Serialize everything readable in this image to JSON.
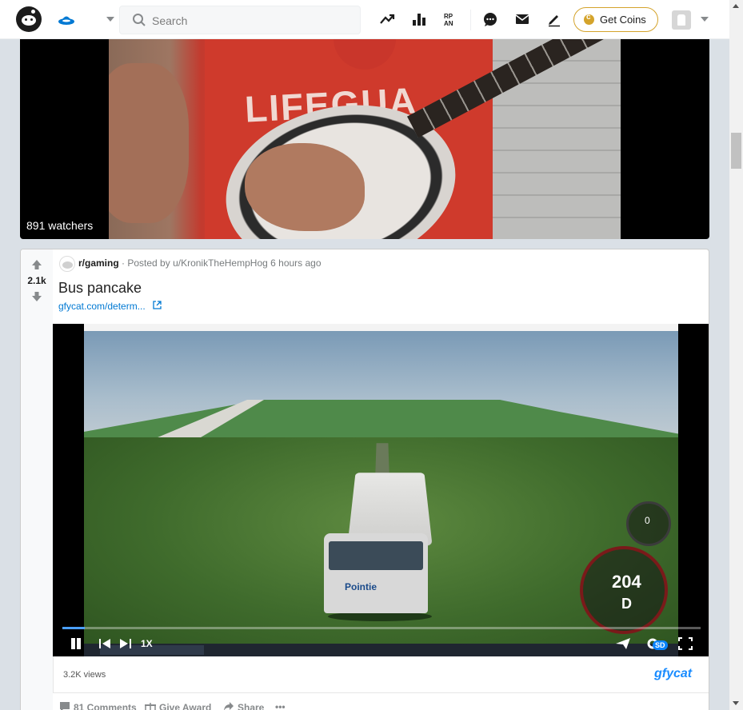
{
  "header": {
    "search_placeholder": "Search",
    "coins_label": "Get Coins",
    "icons": [
      "popular-icon",
      "leaderboard-icon",
      "rpan-icon",
      "chat-icon",
      "mail-icon",
      "create-post-icon"
    ]
  },
  "top_video": {
    "shirt_text": "LIFEGUA",
    "watchers": "891 watchers"
  },
  "post": {
    "votes": "2.1k",
    "subreddit": "r/gaming",
    "posted_by_prefix": "· Posted by",
    "author": "u/KronikTheHempHog",
    "time": "6 hours ago",
    "title": "Bus pancake",
    "link": "gfycat.com/determ...",
    "media": {
      "speed_display": "204",
      "gear_display": "D",
      "bus_logo": "Pointie",
      "playback_rate": "1X",
      "quality_badge": "SD",
      "progress": 0.035
    },
    "views": "3.2K views",
    "provider": "gfycat",
    "actions": {
      "comments": "81 Comments",
      "award": "Give Award",
      "share": "Share",
      "more": "•••"
    }
  },
  "colors": {
    "brand_blue": "#0079d3",
    "coin_gold": "#d4a32b",
    "page_bg": "#dae0e6"
  }
}
